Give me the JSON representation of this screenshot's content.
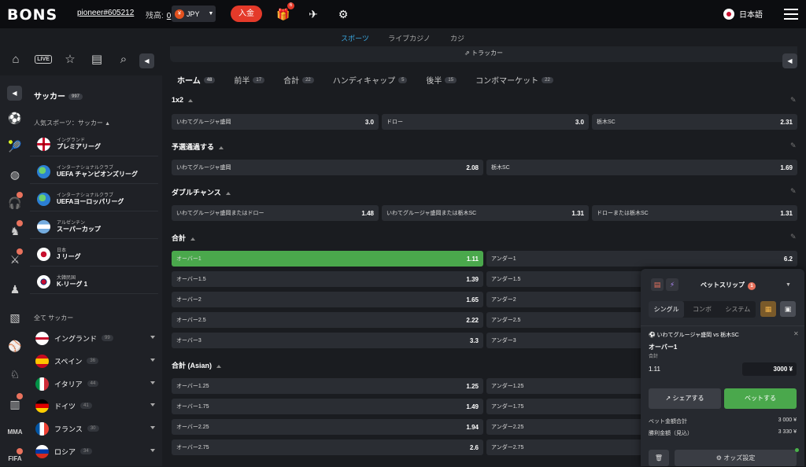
{
  "header": {
    "logo": "BONS",
    "username": "pioneer#605212",
    "balance_label": "残高:",
    "balance_value": "0",
    "currency": "JPY",
    "currency_icon": "¥",
    "deposit_label": "入金",
    "gift_badge": "6",
    "language": "日本語"
  },
  "mode_tabs": [
    {
      "label": "スポーツ",
      "color": "#3aa7e0"
    },
    {
      "label": "ライブカジノ",
      "color": "#e33b3b"
    },
    {
      "label": "カジノ",
      "color": "#4ab34a"
    }
  ],
  "tracker_label": "トラッカー",
  "sidebar": {
    "title": "サッカー",
    "title_count": "997",
    "popular_label": "人気スポーツ：サッカー",
    "leagues": [
      {
        "region": "イングランド",
        "name": "プレミアリーグ",
        "flag": "eng"
      },
      {
        "region": "インターナショナルクラブ",
        "name": "UEFA チャンピオンズリーグ",
        "flag": "world"
      },
      {
        "region": "インターナショナルクラブ",
        "name": "UEFAヨーロッパリーグ",
        "flag": "world"
      },
      {
        "region": "アルゼンチン",
        "name": "スーパーカップ",
        "flag": "arg"
      },
      {
        "region": "日本",
        "name": "J リーグ",
        "flag": "jpn"
      },
      {
        "region": "大韓民国",
        "name": "K-リーグ 1",
        "flag": "kor"
      }
    ],
    "all_label": "全て サッカー",
    "countries": [
      {
        "name": "イングランド",
        "count": "99",
        "flag": "eng"
      },
      {
        "name": "スペイン",
        "count": "36",
        "flag": "esp"
      },
      {
        "name": "イタリア",
        "count": "44",
        "flag": "ita"
      },
      {
        "name": "ドイツ",
        "count": "41",
        "flag": "ger"
      },
      {
        "name": "フランス",
        "count": "30",
        "flag": "fra"
      },
      {
        "name": "ロシア",
        "count": "34",
        "flag": "rus"
      }
    ]
  },
  "market_tabs": [
    {
      "label": "ホーム",
      "count": "48"
    },
    {
      "label": "前半",
      "count": "17"
    },
    {
      "label": "合計",
      "count": "22"
    },
    {
      "label": "ハンディキャップ",
      "count": "5"
    },
    {
      "label": "後半",
      "count": "15"
    },
    {
      "label": "コンボマーケット",
      "count": "22"
    }
  ],
  "markets": {
    "m1x2": {
      "title": "1x2",
      "outcomes": [
        {
          "label": "いわてグルージャ盛岡",
          "odds": "3.0"
        },
        {
          "label": "ドロー",
          "odds": "3.0"
        },
        {
          "label": "栃木SC",
          "odds": "2.31"
        }
      ]
    },
    "qualify": {
      "title": "予選通過する",
      "outcomes": [
        {
          "label": "いわてグルージャ盛岡",
          "odds": "2.08"
        },
        {
          "label": "栃木SC",
          "odds": "1.69"
        }
      ]
    },
    "double": {
      "title": "ダブルチャンス",
      "outcomes": [
        {
          "label": "いわてグルージャ盛岡またはドロー",
          "odds": "1.48"
        },
        {
          "label": "いわてグルージャ盛岡または栃木SC",
          "odds": "1.31"
        },
        {
          "label": "ドローまたは栃木SC",
          "odds": "1.31"
        }
      ]
    },
    "total": {
      "title": "合計",
      "rows": [
        {
          "over": "オーバー1",
          "over_odds": "1.11",
          "under": "アンダー1",
          "under_odds": "6.2"
        },
        {
          "over": "オーバー1.5",
          "over_odds": "1.39",
          "under": "アンダー1.5",
          "under_odds": ""
        },
        {
          "over": "オーバー2",
          "over_odds": "1.65",
          "under": "アンダー2",
          "under_odds": ""
        },
        {
          "over": "オーバー2.5",
          "over_odds": "2.22",
          "under": "アンダー2.5",
          "under_odds": ""
        },
        {
          "over": "オーバー3",
          "over_odds": "3.3",
          "under": "アンダー3",
          "under_odds": ""
        }
      ]
    },
    "asian": {
      "title": "合計 (Asian)",
      "rows": [
        {
          "over": "オーバー1.25",
          "over_odds": "1.25",
          "under": "アンダー1.25"
        },
        {
          "over": "オーバー1.75",
          "over_odds": "1.49",
          "under": "アンダー1.75"
        },
        {
          "over": "オーバー2.25",
          "over_odds": "1.94",
          "under": "アンダー2.25"
        },
        {
          "over": "オーバー2.75",
          "over_odds": "2.6",
          "under": "アンダー2.75"
        }
      ]
    }
  },
  "betslip": {
    "title": "ベットスリップ",
    "badge": "1",
    "types": [
      "シングル",
      "コンボ",
      "システム"
    ],
    "match": "いわてグルージャ盛岡 vs 栃木SC",
    "pick": "オーバー1",
    "market": "合計",
    "odds": "1.11",
    "stake": "3000 ¥",
    "share_label": "シェアする",
    "place_label": "ベットする",
    "total_label": "ベット金額合計",
    "total_value": "3 000 ¥",
    "win_label": "勝利金額（見込）",
    "win_value": "3 330 ¥",
    "settings_label": "オッズ設定"
  }
}
